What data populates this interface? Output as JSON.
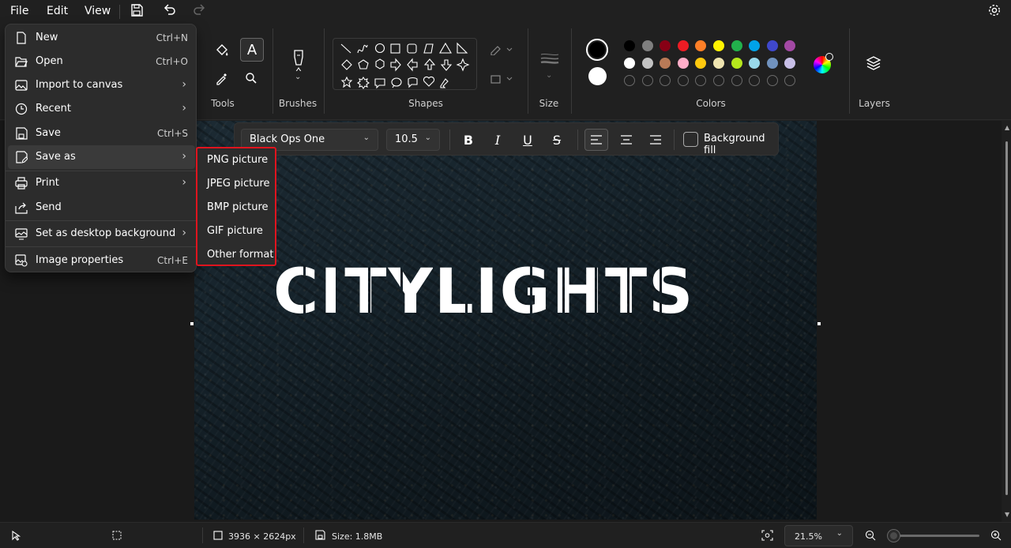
{
  "menubar": {
    "file": "File",
    "edit": "Edit",
    "view": "View"
  },
  "ribbon": {
    "tools_label": "Tools",
    "brushes_label": "Brushes",
    "shapes_label": "Shapes",
    "size_label": "Size",
    "colors_label": "Colors",
    "layers_label": "Layers",
    "color_primary": "#000000",
    "color_secondary": "#ffffff",
    "palette_row1": [
      "#000000",
      "#7f7f7f",
      "#880015",
      "#ed1c24",
      "#ff7f27",
      "#fff200",
      "#22b14c",
      "#00a2e8",
      "#3f48cc",
      "#a349a4"
    ],
    "palette_row2": [
      "#ffffff",
      "#c3c3c3",
      "#b97a57",
      "#ffaec9",
      "#ffc90e",
      "#efe4b0",
      "#b5e61d",
      "#99d9ea",
      "#7092be",
      "#c8bfe7"
    ]
  },
  "texttoolbar": {
    "font": "Black Ops One",
    "size": "10.5",
    "bold": "B",
    "italic": "I",
    "underline": "U",
    "strike": "S",
    "background_fill": "Background fill"
  },
  "canvas": {
    "text": "CITYLIGHTS"
  },
  "filemenu": {
    "items": [
      {
        "label": "New",
        "shortcut": "Ctrl+N"
      },
      {
        "label": "Open",
        "shortcut": "Ctrl+O"
      },
      {
        "label": "Import to canvas",
        "shortcut": ""
      },
      {
        "label": "Recent",
        "shortcut": ""
      },
      {
        "label": "Save",
        "shortcut": "Ctrl+S"
      },
      {
        "label": "Save as",
        "shortcut": ""
      },
      {
        "label": "Print",
        "shortcut": ""
      },
      {
        "label": "Send",
        "shortcut": ""
      },
      {
        "label": "Set as desktop background",
        "shortcut": ""
      },
      {
        "label": "Image properties",
        "shortcut": "Ctrl+E"
      }
    ]
  },
  "saveas_submenu": [
    "PNG picture",
    "JPEG picture",
    "BMP picture",
    "GIF picture",
    "Other format"
  ],
  "statusbar": {
    "dimensions": "3936 × 2624px",
    "size": "Size: 1.8MB",
    "zoom": "21.5%"
  }
}
